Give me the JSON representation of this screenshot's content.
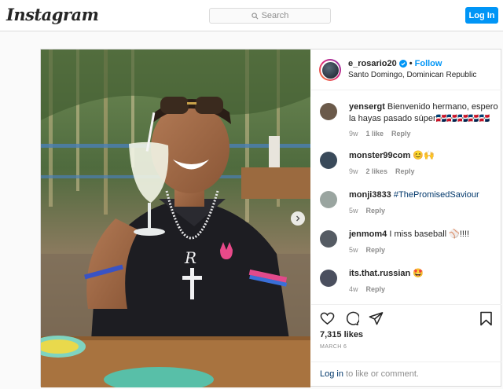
{
  "header": {
    "logo_text": "Instagram",
    "search_placeholder": "Search",
    "login_label": "Log In"
  },
  "post": {
    "username": "e_rosario20",
    "follow_label": "Follow",
    "separator": "•",
    "location": "Santo Domingo, Dominican Republic",
    "likes": "7,315 likes",
    "date": "MARCH 6",
    "login_prompt_link": "Log in",
    "login_prompt_rest": " to like or comment."
  },
  "comments": [
    {
      "user": "yensergt",
      "text": "Bienvenido hermano, espero la hayas pasado súper🇩🇴🇩🇴🇩🇴🇩🇴🇩🇴",
      "time": "9w",
      "likes": "1 like",
      "reply": "Reply",
      "avatar_color": "#6b5a4a"
    },
    {
      "user": "monster99com",
      "text": "😊🙌",
      "time": "9w",
      "likes": "2 likes",
      "reply": "Reply",
      "avatar_color": "#3a4a5a"
    },
    {
      "user": "monji3833",
      "text": "#ThePromisedSaviour",
      "time": "5w",
      "likes": "",
      "reply": "Reply",
      "avatar_color": "#9aa5a0"
    },
    {
      "user": "jenmom4",
      "text": "I miss baseball ⚾!!!!",
      "time": "5w",
      "likes": "",
      "reply": "Reply",
      "avatar_color": "#555b63"
    },
    {
      "user": "its.that.russian",
      "text": "🤩",
      "time": "4w",
      "likes": "",
      "reply": "Reply",
      "avatar_color": "#4a4f5e"
    }
  ],
  "colors": {
    "accent": "#0095f6",
    "link": "#00376b",
    "border": "#dbdbdb",
    "muted": "#8e8e8e"
  },
  "icons": [
    "search-icon",
    "verified-badge-icon",
    "heart-icon",
    "comment-icon",
    "share-icon",
    "bookmark-icon",
    "chevron-right-icon"
  ]
}
